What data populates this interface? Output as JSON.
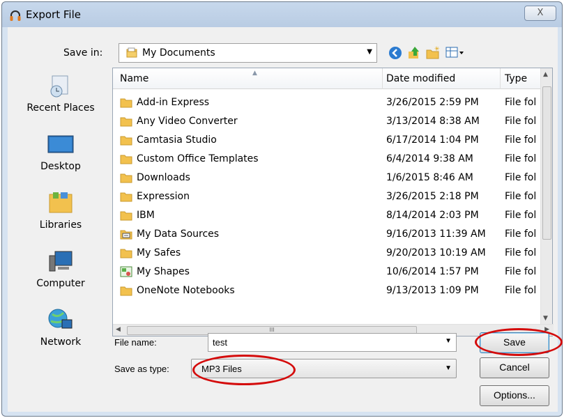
{
  "window": {
    "title": "Export File",
    "close_glyph": "X"
  },
  "toolbar": {
    "save_in_label": "Save in:",
    "save_in_value": "My Documents",
    "icons": [
      "back-icon",
      "up-folder-icon",
      "new-folder-icon",
      "view-menu-icon"
    ]
  },
  "places": [
    {
      "label": "Recent Places",
      "icon": "recent-places-icon"
    },
    {
      "label": "Desktop",
      "icon": "desktop-icon"
    },
    {
      "label": "Libraries",
      "icon": "libraries-icon"
    },
    {
      "label": "Computer",
      "icon": "computer-icon"
    },
    {
      "label": "Network",
      "icon": "network-icon"
    }
  ],
  "filelist": {
    "columns": [
      "Name",
      "Date modified",
      "Type"
    ],
    "rows": [
      {
        "name": "Add-in Express",
        "date": "3/26/2015 2:59 PM",
        "type": "File fol",
        "icon": "folder"
      },
      {
        "name": "Any Video Converter",
        "date": "3/13/2014 8:38 AM",
        "type": "File fol",
        "icon": "folder"
      },
      {
        "name": "Camtasia Studio",
        "date": "6/17/2014 1:04 PM",
        "type": "File fol",
        "icon": "folder"
      },
      {
        "name": "Custom Office Templates",
        "date": "6/4/2014 9:38 AM",
        "type": "File fol",
        "icon": "folder"
      },
      {
        "name": "Downloads",
        "date": "1/6/2015 8:46 AM",
        "type": "File fol",
        "icon": "folder"
      },
      {
        "name": "Expression",
        "date": "3/26/2015 2:18 PM",
        "type": "File fol",
        "icon": "folder"
      },
      {
        "name": "IBM",
        "date": "8/14/2014 2:03 PM",
        "type": "File fol",
        "icon": "folder"
      },
      {
        "name": "My Data Sources",
        "date": "9/16/2013 11:39 AM",
        "type": "File fol",
        "icon": "data-sources"
      },
      {
        "name": "My Safes",
        "date": "9/20/2013 10:19 AM",
        "type": "File fol",
        "icon": "folder"
      },
      {
        "name": "My Shapes",
        "date": "10/6/2014 1:57 PM",
        "type": "File fol",
        "icon": "shapes"
      },
      {
        "name": "OneNote Notebooks",
        "date": "9/13/2013 1:09 PM",
        "type": "File fol",
        "icon": "folder"
      }
    ],
    "hscroll_grip": "III"
  },
  "form": {
    "file_name_label": "File name:",
    "file_name_value": "test",
    "save_as_type_label": "Save as type:",
    "save_as_type_value": "MP3 Files"
  },
  "buttons": {
    "save": "Save",
    "cancel": "Cancel",
    "options": "Options..."
  },
  "colors": {
    "highlight": "#d40b0b",
    "folder": "#f2c14e"
  }
}
